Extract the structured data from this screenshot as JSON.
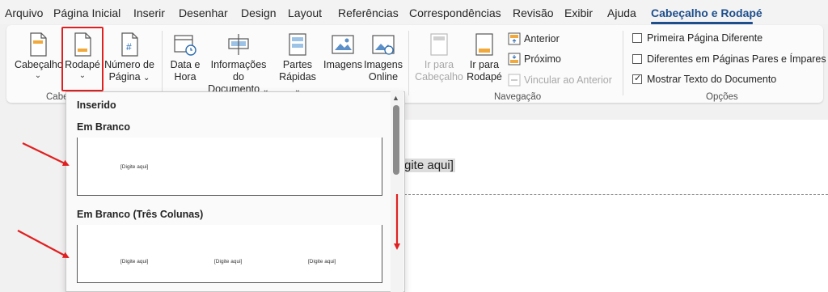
{
  "menu": {
    "items": [
      "Arquivo",
      "Página Inicial",
      "Inserir",
      "Desenhar",
      "Design",
      "Layout",
      "Referências",
      "Correspondências",
      "Revisão",
      "Exibir",
      "Ajuda"
    ],
    "active": "Cabeçalho e Rodapé"
  },
  "ribbon": {
    "header_footer": {
      "cabecalho": "Cabeçalho",
      "rodape": "Rodapé",
      "numero_line1": "Número de",
      "numero_line2": "Página",
      "group_label": "Cabe"
    },
    "insert": {
      "data_line1": "Data e",
      "data_line2": "Hora",
      "info_line1": "Informações do",
      "info_line2": "Documento",
      "partes_line1": "Partes",
      "partes_line2": "Rápidas",
      "imagens": "Imagens",
      "imagens_online_line1": "Imagens",
      "imagens_online_line2": "Online"
    },
    "navigation": {
      "ir_cab_line1": "Ir para",
      "ir_cab_line2": "Cabeçalho",
      "ir_rod_line1": "Ir para",
      "ir_rod_line2": "Rodapé",
      "anterior": "Anterior",
      "proximo": "Próximo",
      "vincular": "Vincular ao Anterior",
      "group_label": "Navegação"
    },
    "options": {
      "primeira": "Primeira Página Diferente",
      "diferentes": "Diferentes em Páginas Pares e Ímpares",
      "mostrar": "Mostrar Texto do Documento",
      "mostrar_checked": true,
      "group_label": "Opções"
    }
  },
  "gallery": {
    "section": "Inserido",
    "item1_title": "Em Branco",
    "item1_placeholder": "[Digite aqui]",
    "item2_title": "Em Branco (Três Colunas)",
    "item2_placeholders": [
      "[Digite aqui]",
      "[Digite aqui]",
      "[Digite aqui]"
    ]
  },
  "document": {
    "visible_text": "gite aqui]"
  },
  "colors": {
    "accent": "#1e4e8c",
    "annotation_red": "#e02020"
  }
}
